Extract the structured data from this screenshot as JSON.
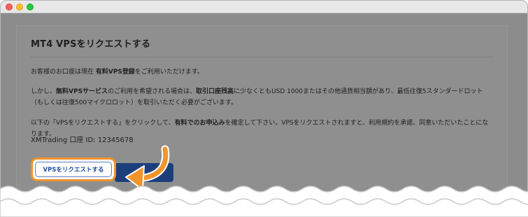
{
  "window": {
    "controls": [
      "close",
      "minimize",
      "maximize"
    ]
  },
  "card": {
    "title": "MT4 VPSをリクエストする",
    "p1": {
      "a": "お客様のお口座は現在 ",
      "b": "有料VPS登録",
      "c": "をご利用いただけます。"
    },
    "p2": {
      "a": "しかし、",
      "b": "無料VPSサービス",
      "c": "のご利用を希望される場合は、",
      "d": "取引口座残高",
      "e": "に少なくともUSD 1000またはその他通貨相当額があり、最低往復5スタンダードロット（もしくは往復500マイクロロット）を取引いただく必要がございます。"
    },
    "p3": {
      "a": "以下の「VPSをリクエストする」をクリックして、",
      "b": "有料でのお申込み",
      "c": "を確定して下さい。VPSをリクエストされますと、利用規約を承諾、同意いただいたことになります。"
    },
    "account": "XMTrading 口座 ID: 12345678",
    "request_button": "VPSをリクエストする"
  },
  "colors": {
    "accent": "#f0942b",
    "button_dark": "#1c3f7c",
    "overlay": "#8c8c8c"
  },
  "icons": [
    "pointing-arrow-icon"
  ]
}
